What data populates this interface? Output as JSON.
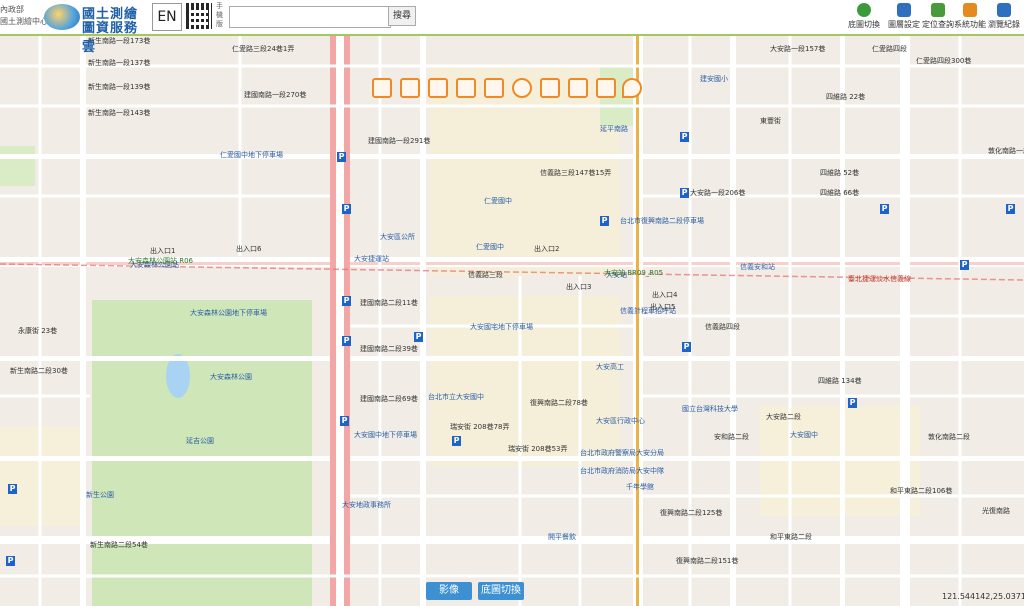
{
  "header": {
    "org_line1": "內政部",
    "org_line2": "國土測繪中心",
    "title_line1": "國土測繪",
    "title_line2": "圖資服務雲",
    "lang_button": "EN",
    "qr_label": "手機版",
    "search_placeholder": "",
    "search_button": "搜尋"
  },
  "right_tools": [
    {
      "label": "底圖切換",
      "icon": "globe-icon",
      "color": "#3c9a3c"
    },
    {
      "label": "圖層設定",
      "icon": "layers-icon",
      "color": "#2f6fbf"
    },
    {
      "label": "定位查詢",
      "icon": "locate-icon",
      "color": "#4a9a3c"
    },
    {
      "label": "系統功能",
      "icon": "system-icon",
      "color": "#e58a1f"
    },
    {
      "label": "瀏覽紀錄",
      "icon": "history-icon",
      "color": "#2f6fbf"
    }
  ],
  "map_tool_icons": [
    "zoom-in-icon",
    "building-icon",
    "draw-icon",
    "measure-icon",
    "hand-icon",
    "point-icon",
    "line-icon",
    "polygon-icon",
    "eraser-icon",
    "marker-icon"
  ],
  "streets": [
    "新生南路一段173巷",
    "新生南路一段137巷",
    "新生南路一段139巷",
    "新生南路一段143巷",
    "仁愛路三段24巷1弄",
    "建國南路一段270巷",
    "建國南路一段291巷",
    "東豐街",
    "信義路三段147巷15弄",
    "信義路三段",
    "信義路四段",
    "大安路一段206巷",
    "四維路 52巷",
    "四維路 66巷",
    "建國南路二段11巷",
    "建國南路二段39巷",
    "建國南路二段69巷",
    "瑞安街 208巷78弄",
    "瑞安街 208巷53弄",
    "復興南路二段78巷",
    "復興南路二段125巷",
    "復興南路二段151巷",
    "敦化南路二段",
    "新生南路二段30巷",
    "新生南路二段54巷",
    "永康街 23巷",
    "和平東路二段",
    "四維路 134巷",
    "大安路一段157巷",
    "四維路 22巷",
    "仁愛路四段",
    "仁愛路四段300巷",
    "敦化南路一段",
    "大安路二段",
    "安和路二段",
    "和平東路二段106巷",
    "光復南路"
  ],
  "places": [
    "大安森林公園",
    "仁愛國中",
    "延平南路",
    "大安國中",
    "仁愛國中",
    "大安捷運站",
    "信義計程車招呼站",
    "國立台灣科技大學",
    "大安區行政中心",
    "台北市立大安國中",
    "大安高工",
    "大安森林公園地下停車場",
    "台北市復興南路二段停車場",
    "大安國宅地下停車場",
    "大安森林公園站",
    "大安站",
    "信義安和站",
    "台北市政府警察局大安分局",
    "大安區公所",
    "延吉公園",
    "台北市政府消防局大安中隊",
    "千年學館",
    "大安國中地下停車場",
    "開平餐飲",
    "大安地政事務所",
    "新生公園",
    "建安國小",
    "仁愛國中地下停車場",
    "出入口1",
    "出入口2",
    "出入口3",
    "出入口4",
    "出入口5",
    "出入口6"
  ],
  "station_labels": {
    "daan_park": "大安森林公園站 R06",
    "daan": "大安站 BR09_R05",
    "tunnel": "臺北捷運淡水信義線"
  },
  "coordinates": "121.544142,25.03718",
  "bottom_buttons": {
    "image": "影像",
    "basemap": "底圖切換"
  },
  "colors": {
    "accent": "#a4c75e",
    "brand": "#1f5fa8",
    "park": "#c8e2b1",
    "parking": "#1f63c6",
    "metro": "#e07070"
  }
}
